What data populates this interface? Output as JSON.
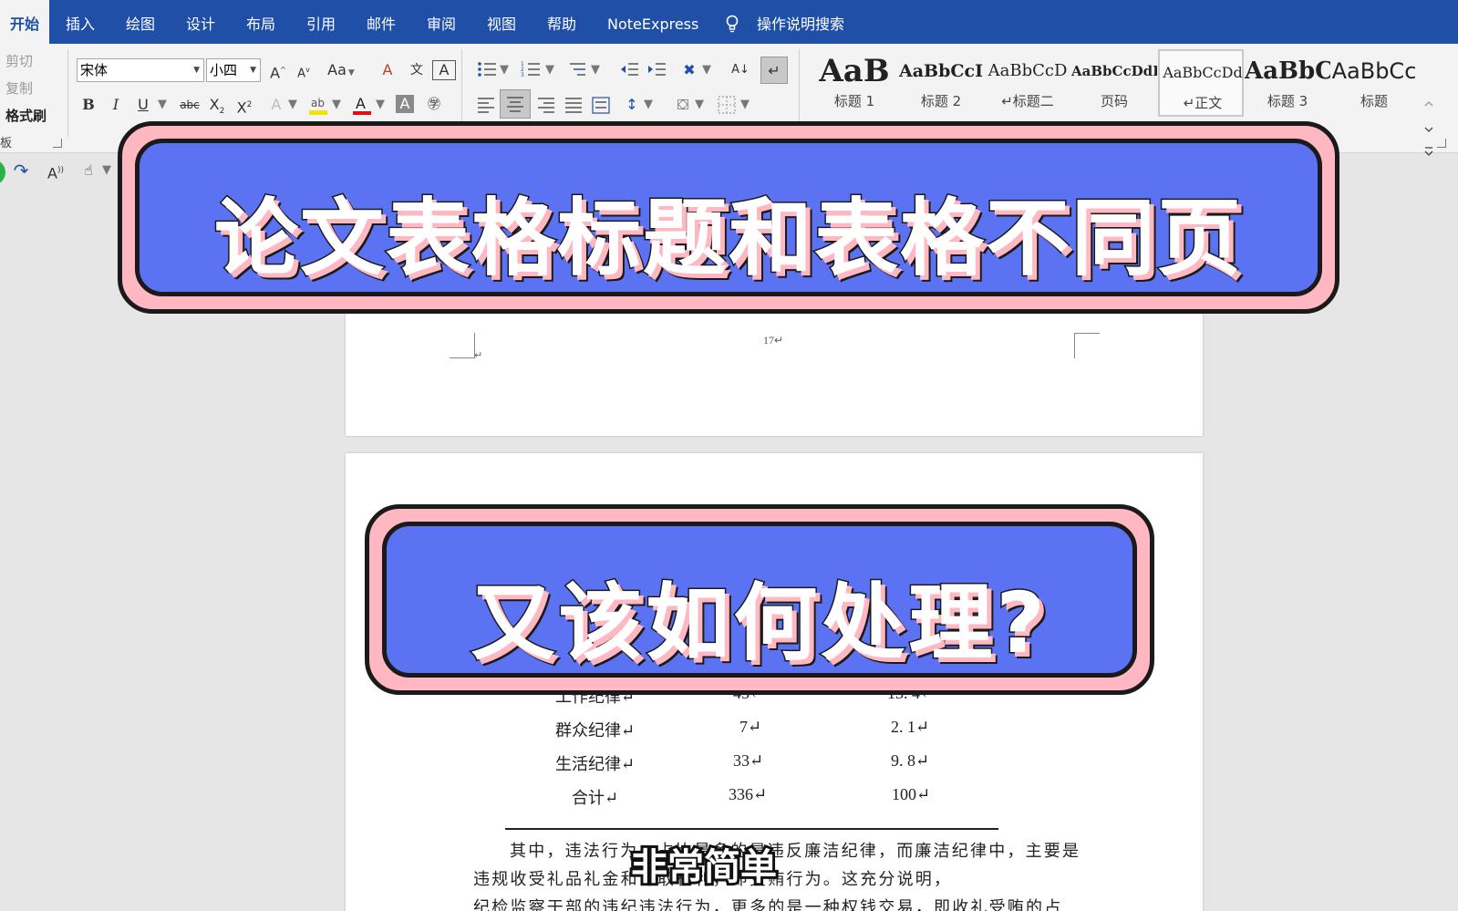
{
  "menu": {
    "tabs": [
      "开始",
      "插入",
      "绘图",
      "设计",
      "布局",
      "引用",
      "邮件",
      "审阅",
      "视图",
      "帮助",
      "NoteExpress"
    ],
    "search_label": "操作说明搜索"
  },
  "clipboard": {
    "cut": "剪切",
    "copy": "复制",
    "format_painter": "格式刷",
    "group_label": "板"
  },
  "font": {
    "name": "宋体",
    "size": "小四",
    "bold": "B",
    "italic": "I",
    "underline": "U",
    "change_case": "Aa",
    "strike": "abc"
  },
  "styles": [
    {
      "sample": "AaB",
      "name": "标题 1"
    },
    {
      "sample": "AaBbCcI",
      "name": "标题 2"
    },
    {
      "sample": "AaBbCcD",
      "name": "↵标题二"
    },
    {
      "sample": "AaBbCcDdI",
      "name": "页码"
    },
    {
      "sample": "AaBbCcDd",
      "name": "↵正文"
    },
    {
      "sample": "AaBbC",
      "name": "标题 3"
    },
    {
      "sample": "AaBbCc",
      "name": "标题"
    }
  ],
  "document": {
    "page_number": "17↵",
    "table_rows": [
      {
        "category": "工作纪律↵",
        "count": "45↵",
        "percent": "13. 4↵"
      },
      {
        "category": "群众纪律↵",
        "count": "7↵",
        "percent": "2. 1↵"
      },
      {
        "category": "生活纪律↵",
        "count": "33↵",
        "percent": "9. 8↵"
      },
      {
        "category": "合计↵",
        "count": "336↵",
        "percent": "100↵"
      }
    ],
    "body_lines": [
      "其中，违法行为，占比最多的是违反廉洁纪律，而廉洁纪律中，主要是",
      "违规收受礼品礼金和谋取私利，即受贿行为。这充分说明，",
      "纪检监察干部的违纪违法行为，更多的是一种权钱交易，即收礼受贿的占"
    ]
  },
  "overlay": {
    "title": "论文表格标题和表格不同页",
    "question": "又该如何处理?",
    "subtitle": "非常简单"
  },
  "colors": {
    "menu_bar": "#1f4fa6",
    "banner_fill": "#5b72f2",
    "banner_border": "#ffb8c2",
    "highlight_yellow": "#f3e10a",
    "font_color_red": "#e01010"
  }
}
